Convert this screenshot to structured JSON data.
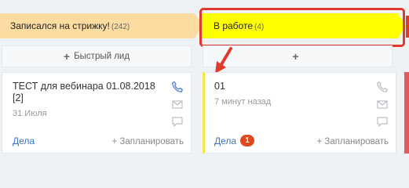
{
  "stages": [
    {
      "title": "Записался на стрижку!",
      "count": "(242)",
      "color": "#fcdca1",
      "quick_lead": "Быстрый лид"
    },
    {
      "title": "В работе",
      "count": "(4)",
      "color": "#ffff00",
      "quick_lead": ""
    }
  ],
  "cards": [
    {
      "title": "ТЕСТ для вебинара 01.08.2018 [2]",
      "date": "31 Июля",
      "tasks_label": "Дела",
      "schedule_label": "Запланировать",
      "phone_icon": "phone-icon",
      "mail_icon": "mail-icon",
      "chat_icon": "chat-icon"
    },
    {
      "title": "01",
      "date": "7 минут назад",
      "tasks_label": "Дела",
      "tasks_badge": "1",
      "schedule_label": "Запланировать",
      "phone_icon": "phone-icon",
      "mail_icon": "mail-icon",
      "chat_icon": "chat-icon"
    }
  ],
  "annotation": {
    "frame_color": "#e03a2f",
    "arrow_color": "#e03a2f"
  }
}
